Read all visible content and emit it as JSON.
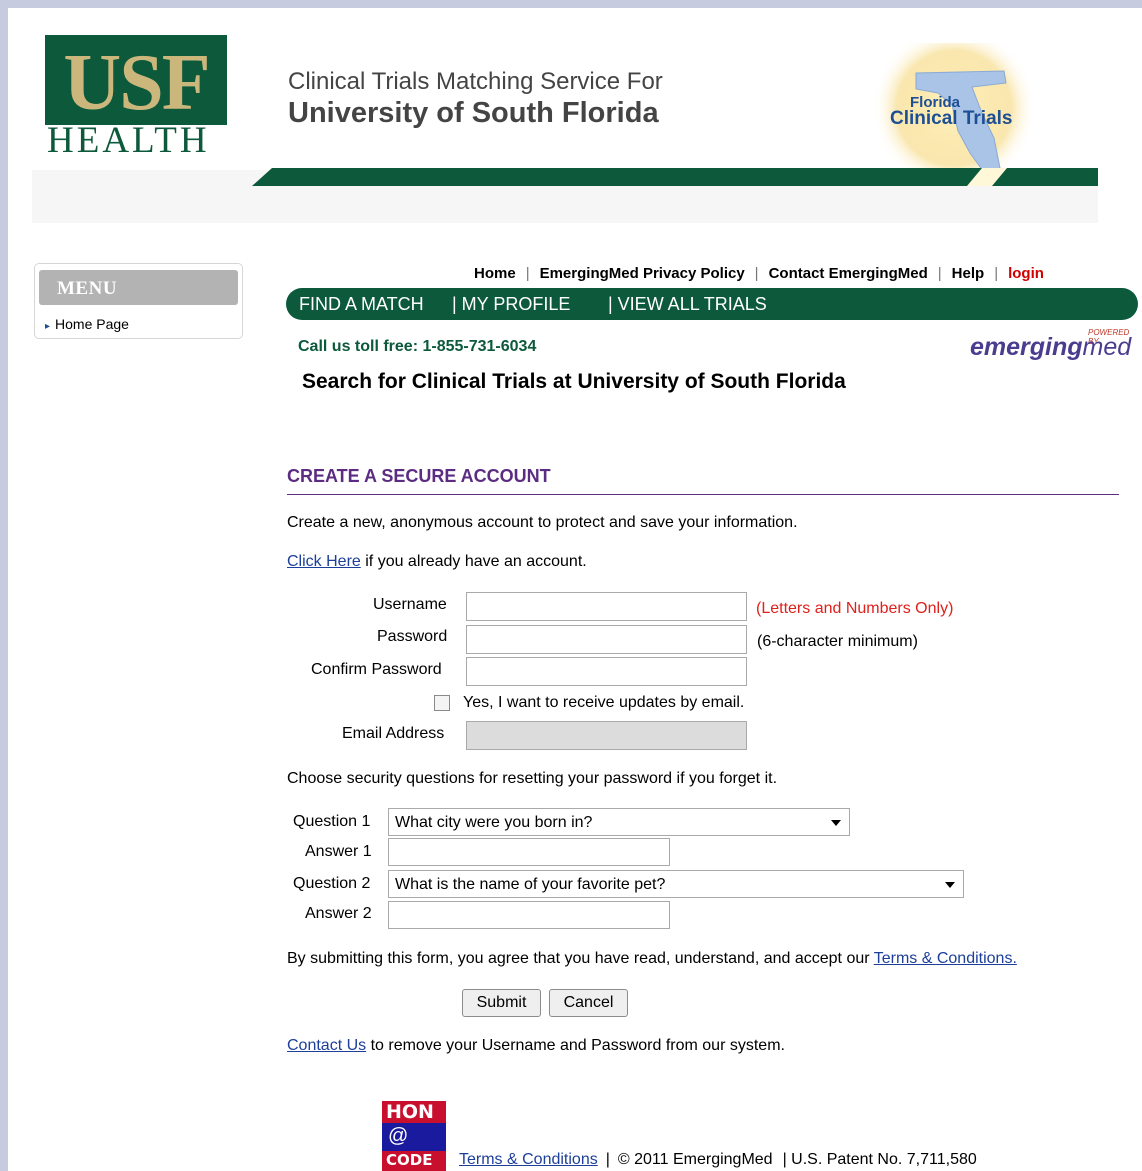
{
  "header": {
    "logo_top": "USF",
    "logo_bottom": "HEALTH",
    "tagline_line1": "Clinical Trials Matching Service For",
    "tagline_line2": "University of South Florida",
    "badge_line1": "Florida",
    "badge_line2": "Clinical Trials"
  },
  "sidebar": {
    "title": "MENU",
    "items": [
      {
        "label": "Home Page"
      }
    ]
  },
  "toplinks": {
    "home": "Home",
    "privacy": "EmergingMed Privacy Policy",
    "contact": "Contact EmergingMed",
    "help": "Help",
    "login": "login",
    "separator": "|"
  },
  "mainnav": {
    "find_match": "FIND A MATCH",
    "my_profile": "| MY PROFILE",
    "view_all": "| VIEW ALL TRIALS"
  },
  "brand": {
    "toll_free": "Call us toll free: 1-855-731-6034",
    "powered_by": "POWERED BY",
    "name_a": "emerging",
    "name_b": "med"
  },
  "page_title": "Search for Clinical Trials at University of South Florida",
  "form": {
    "section_title": "CREATE A SECURE ACCOUNT",
    "intro": "Create a new, anonymous account to protect and save your information.",
    "click_here": "Click Here",
    "click_here_rest": " if you already have an account.",
    "username_label": "Username",
    "username_hint": "(Letters and Numbers Only)",
    "password_label": "Password",
    "password_hint": "(6-character minimum)",
    "confirm_label": "Confirm Password",
    "updates_label": "Yes, I want to receive updates by email.",
    "updates_checked": false,
    "email_label": "Email Address",
    "security_intro": "Choose security questions for resetting your password if you forget it.",
    "question1_label": "Question 1",
    "question1_value": "What city were you born in?",
    "answer1_label": "Answer 1",
    "question2_label": "Question 2",
    "question2_value": "What is the name of your favorite pet?",
    "answer2_label": "Answer 2",
    "agree_text": "By submitting this form, you agree that you have read, understand, and accept our ",
    "agree_link": "Terms & Conditions.",
    "submit": "Submit",
    "cancel": "Cancel",
    "contact_link": "Contact Us",
    "contact_rest": " to remove your Username and Password from our system."
  },
  "footer": {
    "hon_top": "HON",
    "hon_mid": "@",
    "hon_bottom": "CODE",
    "terms": "Terms & Conditions",
    "copyright": "© 2011 EmergingMed",
    "patent": "| U.S. Patent No. 7,711,580",
    "separator": "|"
  },
  "colors": {
    "brand_green": "#0c5a3b",
    "usf_gold": "#cbb77c",
    "section_purple": "#5b2c82",
    "login_red": "#d10000",
    "hint_red": "#e0201b",
    "link_blue": "#1d3f9a"
  }
}
